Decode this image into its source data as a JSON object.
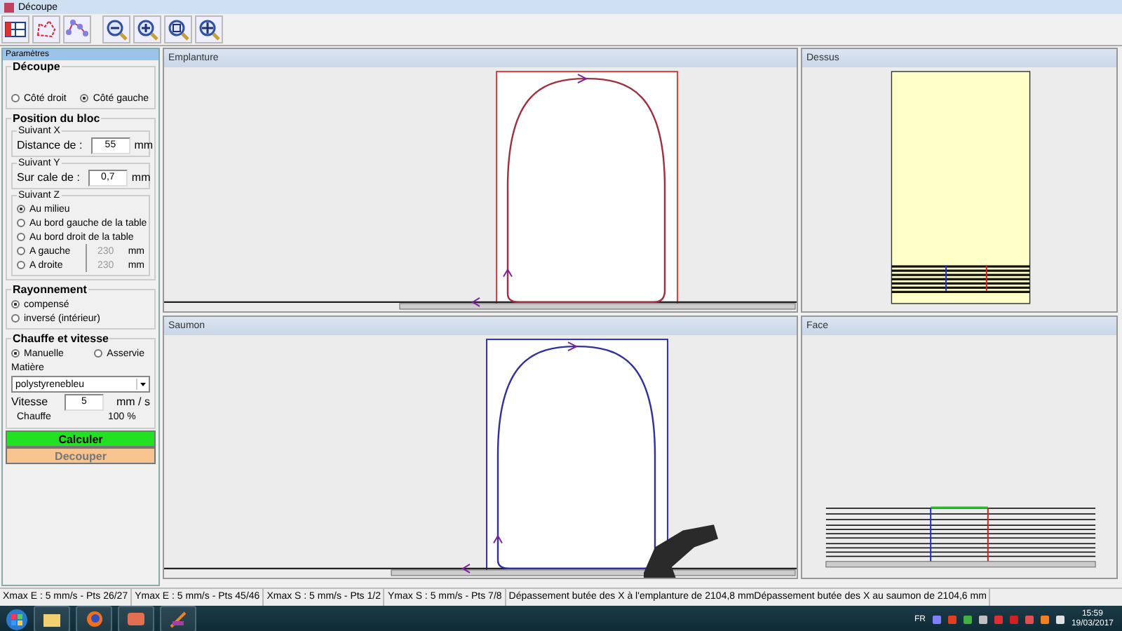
{
  "window": {
    "title": "Découpe"
  },
  "toolbar": {
    "buttons": [
      {
        "kind": "grid"
      },
      {
        "kind": "outline"
      },
      {
        "kind": "nodes"
      },
      {
        "kind": "zoomout"
      },
      {
        "kind": "zoomin"
      },
      {
        "kind": "zoomfit"
      },
      {
        "kind": "zoomall"
      }
    ]
  },
  "parameters": {
    "title": "Paramètres",
    "decoupe": {
      "title": "Découpe",
      "options": [
        {
          "label": "Côté droit",
          "selected": false
        },
        {
          "label": "Côté gauche",
          "selected": true
        }
      ]
    },
    "position": {
      "title": "Position du bloc",
      "suivant_x": {
        "title": "Suivant X",
        "label": "Distance de :",
        "value": "55",
        "unit": "mm"
      },
      "suivant_y": {
        "title": "Suivant Y",
        "label": "Sur cale de :",
        "value": "0,7",
        "unit": "mm"
      },
      "suivant_z": {
        "title": "Suivant Z",
        "options": [
          {
            "label": "Au milieu",
            "selected": true
          },
          {
            "label": "Au bord gauche de la table",
            "selected": false
          },
          {
            "label": "Au bord droit de la table",
            "selected": false
          },
          {
            "label": "A gauche",
            "selected": false,
            "value": "230",
            "disabled": true,
            "unit": "mm"
          },
          {
            "label": "A droite",
            "selected": false,
            "value": "230",
            "disabled": true,
            "unit": "mm"
          }
        ]
      }
    },
    "rayonnement": {
      "title": "Rayonnement",
      "options": [
        {
          "label": "compensé",
          "selected": true
        },
        {
          "label": "inversé (intérieur)",
          "selected": false
        }
      ]
    },
    "chauffe": {
      "title": "Chauffe et vitesse",
      "modes": [
        {
          "label": "Manuelle",
          "selected": true
        },
        {
          "label": "Asservie",
          "selected": false
        }
      ],
      "matiere_label": "Matière",
      "matiere": "polystyrenebleu",
      "vitesse_label": "Vitesse",
      "vitesse": "5",
      "vitesse_unit": "mm / s",
      "chauffe_label": "Chauffe",
      "chauffe_value": "100 %"
    },
    "actions": [
      {
        "label": "Calculer",
        "kind": "go"
      },
      {
        "label": "Decouper",
        "kind": "cut"
      }
    ]
  },
  "views": [
    {
      "title": "Emplanture",
      "kind": "profile",
      "color": "#e04040"
    },
    {
      "title": "Dessus",
      "kind": "top"
    },
    {
      "title": "Saumon",
      "kind": "profile",
      "color": "#3030d0"
    },
    {
      "title": "Face",
      "kind": "front"
    }
  ],
  "status_bar": [
    "Xmax E : 5 mm/s - Pts 26/27",
    "Ymax E : 5 mm/s - Pts 45/46",
    "Xmax S : 5 mm/s - Pts 1/2",
    "Ymax S : 5 mm/s - Pts 7/8",
    "Dépassement butée des X à l'emplanture de 2104,8 mmDépassement butée des X au saumon de 2104,6 mm"
  ],
  "taskbar": {
    "language": "FR",
    "time": "15:59",
    "date": "19/03/2017"
  }
}
